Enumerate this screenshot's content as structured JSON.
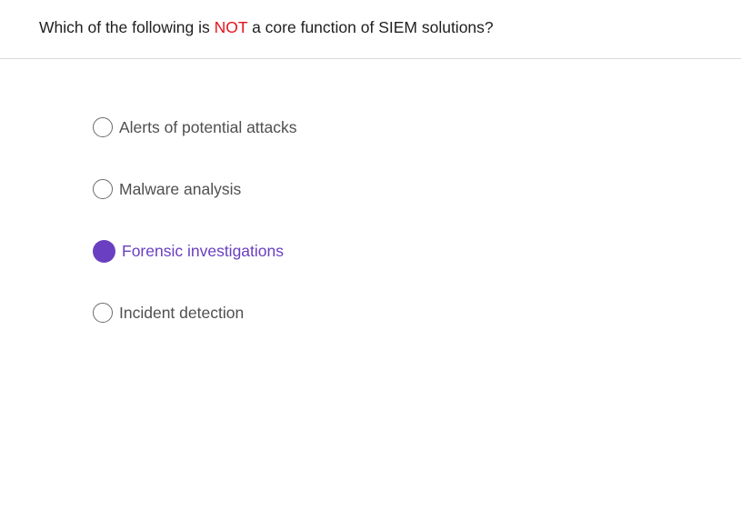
{
  "question": {
    "prefix": "Which of the following is ",
    "emphasis": "NOT",
    "suffix": " a core function of SIEM solutions?"
  },
  "options": [
    {
      "label": "Alerts of potential attacks",
      "selected": false
    },
    {
      "label": "Malware analysis",
      "selected": false
    },
    {
      "label": "Forensic investigations",
      "selected": true
    },
    {
      "label": "Incident detection",
      "selected": false
    }
  ],
  "colors": {
    "accent": "#6a3fc1",
    "emphasis": "#e5141d",
    "text": "#1f1f1f",
    "option_text": "#4f4f4f"
  }
}
